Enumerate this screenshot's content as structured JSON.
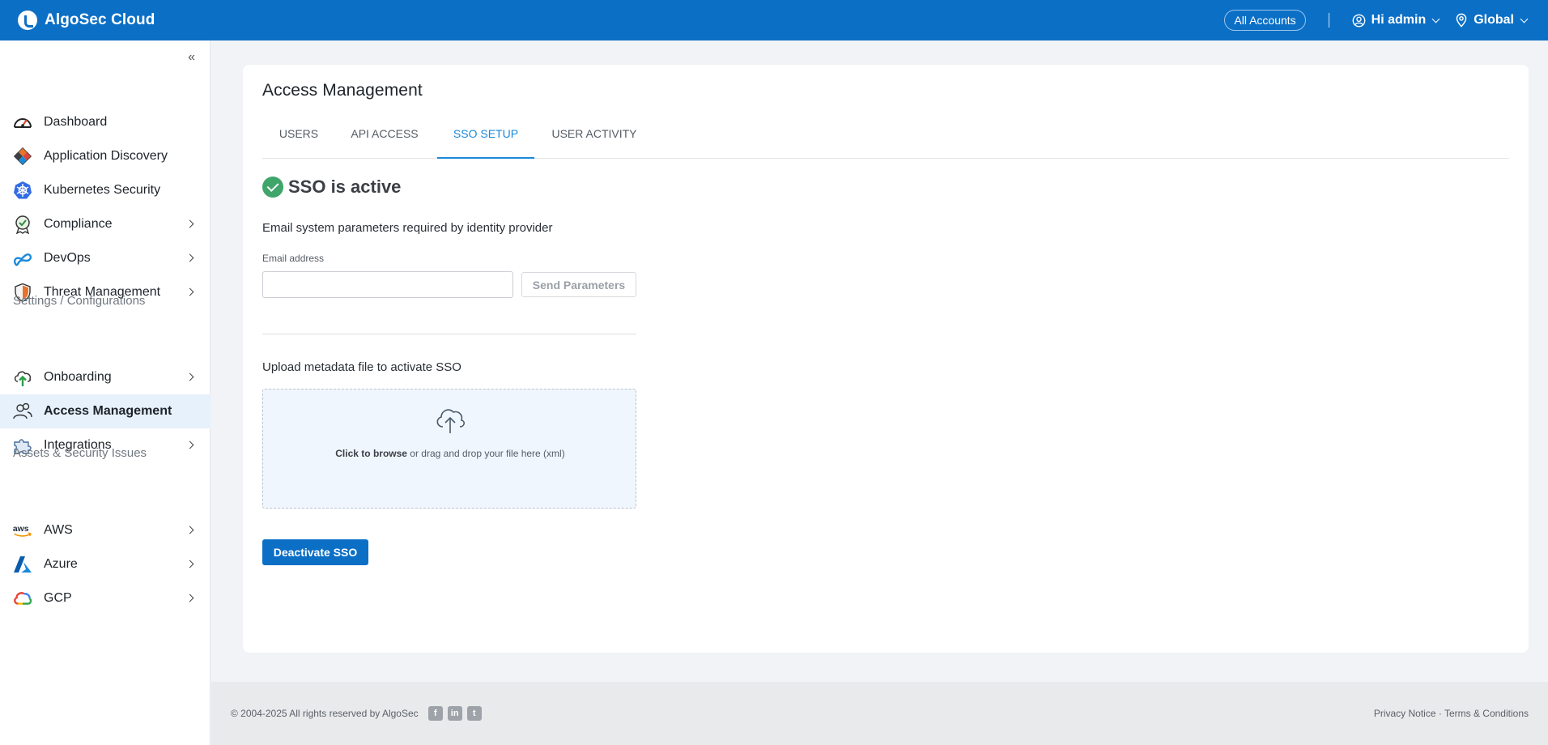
{
  "topbar": {
    "brand": "AlgoSec Cloud",
    "accounts_label": "All Accounts",
    "user_label": "Hi admin",
    "region_label": "Global"
  },
  "sidebar": {
    "items": [
      {
        "label": "Dashboard",
        "icon": "dashboard-icon"
      },
      {
        "label": "Application Discovery",
        "icon": "app-discovery-icon"
      },
      {
        "label": "Kubernetes Security",
        "icon": "kubernetes-icon"
      },
      {
        "label": "Compliance",
        "icon": "compliance-icon"
      },
      {
        "label": "DevOps",
        "icon": "devops-icon"
      },
      {
        "label": "Threat Management",
        "icon": "shield-icon"
      }
    ],
    "settings_heading": "Settings / Configurations",
    "settings_items": [
      {
        "label": "Onboarding",
        "icon": "cloud-upload-icon"
      },
      {
        "label": "Access Management",
        "icon": "users-icon",
        "active": true
      },
      {
        "label": "Integrations",
        "icon": "puzzle-icon"
      }
    ],
    "assets_heading": "Assets & Security Issues",
    "assets_items": [
      {
        "label": "AWS",
        "icon": "aws-icon"
      },
      {
        "label": "Azure",
        "icon": "azure-icon"
      },
      {
        "label": "GCP",
        "icon": "gcp-icon"
      }
    ]
  },
  "main": {
    "title": "Access Management",
    "tabs": [
      {
        "label": "USERS"
      },
      {
        "label": "API ACCESS"
      },
      {
        "label": "SSO SETUP",
        "active": true
      },
      {
        "label": "USER ACTIVITY"
      }
    ],
    "sso_status": "SSO is active",
    "email_section_desc": "Email system parameters required by identity provider",
    "email_label": "Email address",
    "email_value": "",
    "send_button": "Send Parameters",
    "upload_label": "Upload metadata file to activate SSO",
    "drop_browse": "Click to browse",
    "drop_rest": " or drag and drop your file here (xml)",
    "deactivate_button": "Deactivate SSO"
  },
  "footer": {
    "copyright": "© 2004-2025 All rights reserved by AlgoSec",
    "privacy": "Privacy Notice",
    "separator": " · ",
    "terms": "Terms & Conditions"
  },
  "colors": {
    "brand": "#0b6fc6",
    "active_tab": "#1a89d9",
    "success": "#3fa56b"
  }
}
